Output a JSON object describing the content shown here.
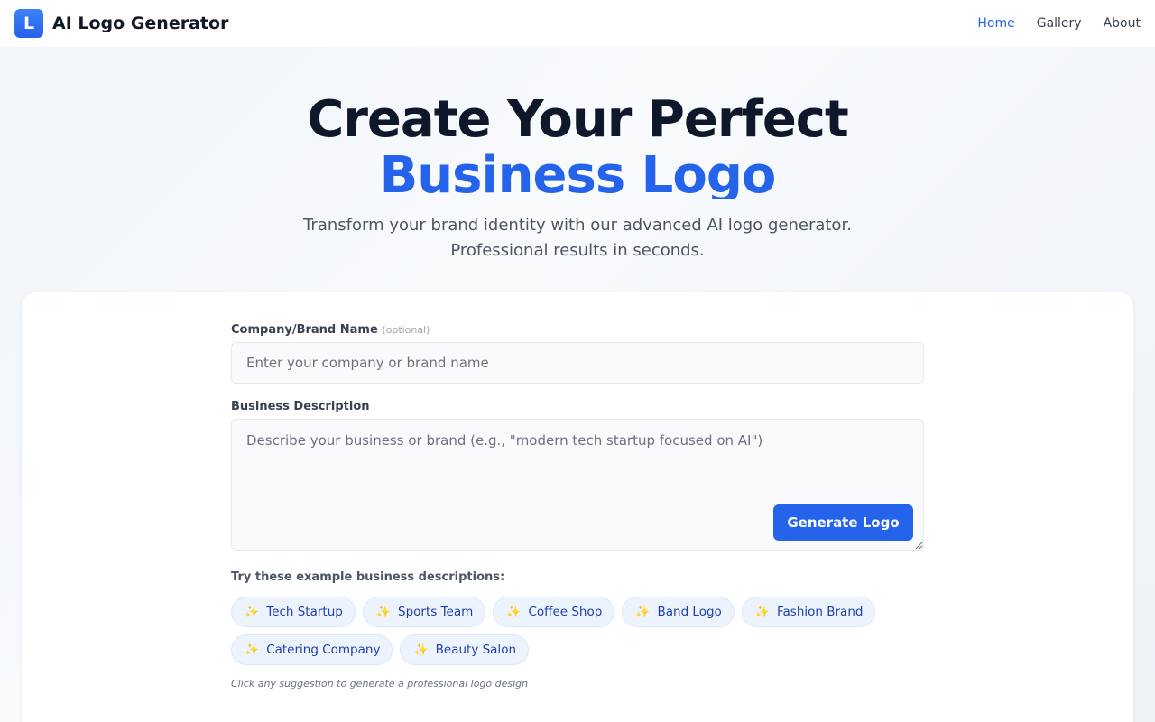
{
  "header": {
    "logo_letter": "L",
    "title": "AI Logo Generator",
    "nav": [
      {
        "label": "Home",
        "active": true
      },
      {
        "label": "Gallery",
        "active": false
      },
      {
        "label": "About",
        "active": false
      }
    ]
  },
  "hero": {
    "line1": "Create Your Perfect",
    "line2": "Business Logo",
    "subtitle_line1": "Transform your brand identity with our advanced AI logo generator.",
    "subtitle_line2": "Professional results in seconds."
  },
  "form": {
    "name_label": "Company/Brand Name",
    "name_optional": "(optional)",
    "name_placeholder": "Enter your company or brand name",
    "name_value": "",
    "desc_label": "Business Description",
    "desc_placeholder": "Describe your business or brand (e.g., \"modern tech startup focused on AI\")",
    "desc_value": "",
    "generate_label": "Generate Logo"
  },
  "examples": {
    "title": "Try these example business descriptions:",
    "chips": [
      {
        "label": "Tech Startup",
        "icon": "sparkle-icon"
      },
      {
        "label": "Sports Team",
        "icon": "sparkle-icon"
      },
      {
        "label": "Coffee Shop",
        "icon": "sparkle-icon"
      },
      {
        "label": "Band Logo",
        "icon": "sparkle-icon"
      },
      {
        "label": "Fashion Brand",
        "icon": "sparkle-icon"
      },
      {
        "label": "Catering Company",
        "icon": "sparkle-icon"
      },
      {
        "label": "Beauty Salon",
        "icon": "sparkle-icon"
      }
    ],
    "hint": "Click any suggestion to generate a professional logo design"
  },
  "colors": {
    "accent": "#2563eb",
    "heading": "#0f172a",
    "sparkle": "#f59e0b"
  }
}
